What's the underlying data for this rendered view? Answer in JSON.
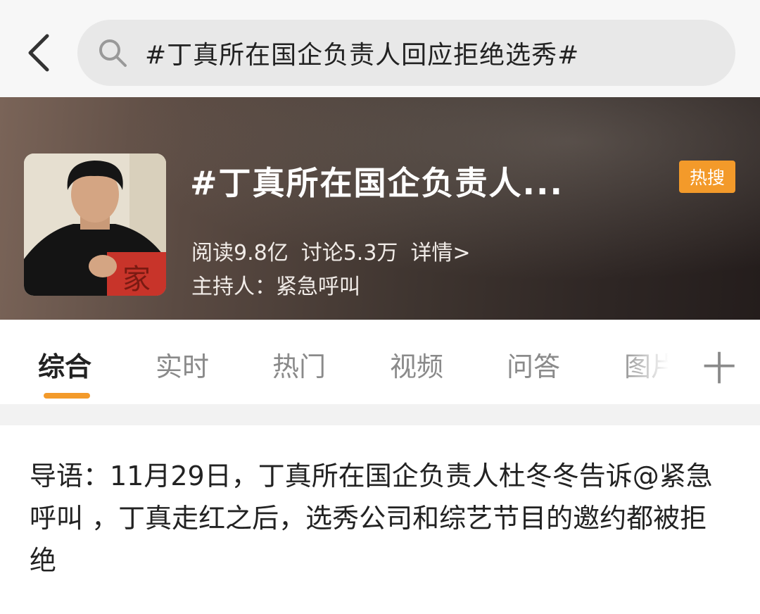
{
  "search": {
    "query": "#丁真所在国企负责人回应拒绝选秀#"
  },
  "topic": {
    "title": "#丁真所在国企负责人...",
    "badge": "热搜",
    "reads": "阅读9.8亿",
    "discussions": "讨论5.3万",
    "details": "详情>",
    "host": "主持人：紧急呼叫"
  },
  "tabs": [
    {
      "label": "综合"
    },
    {
      "label": "实时"
    },
    {
      "label": "热门"
    },
    {
      "label": "视频"
    },
    {
      "label": "问答"
    },
    {
      "label": "图片"
    }
  ],
  "tabs_more": "十",
  "intro": {
    "text": "导语：11月29日，丁真所在国企负责人杜冬冬告诉@紧急呼叫 ，丁真走红之后，选秀公司和综艺节目的邀约都被拒绝"
  },
  "colors": {
    "accent": "#f39a2a",
    "banner_dark": "#2e2624"
  },
  "icons": [
    "back-arrow-icon",
    "search-icon",
    "hot-badge-icon",
    "add-tab-icon"
  ]
}
